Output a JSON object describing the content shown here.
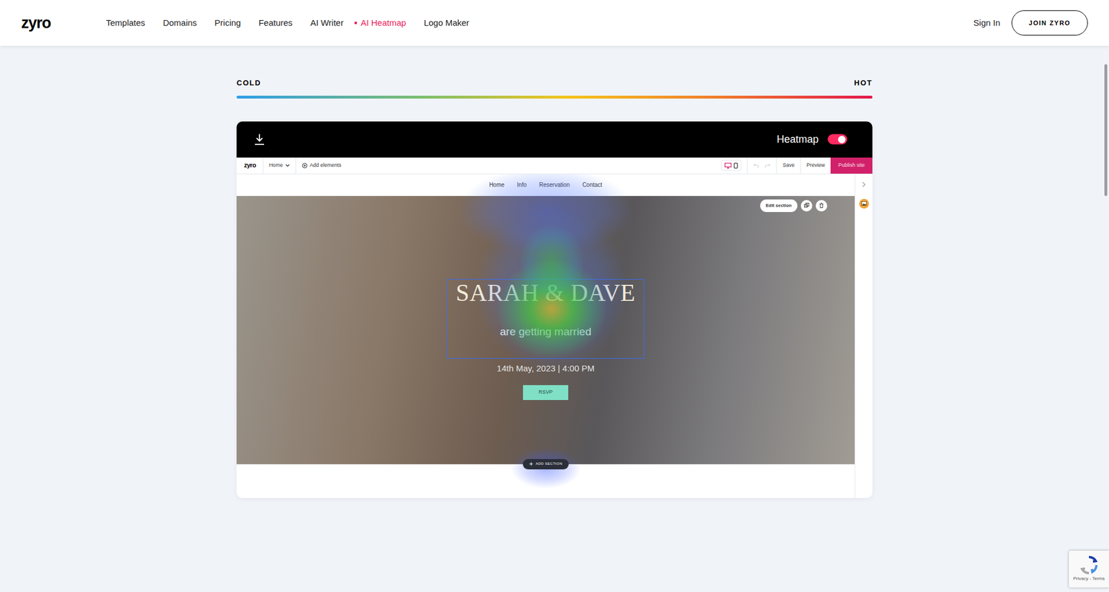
{
  "header": {
    "logo": "zyro",
    "nav": [
      {
        "label": "Templates",
        "selected": false
      },
      {
        "label": "Domains",
        "selected": false
      },
      {
        "label": "Pricing",
        "selected": false
      },
      {
        "label": "Features",
        "selected": false
      },
      {
        "label": "AI Writer",
        "selected": false
      },
      {
        "label": "AI Heatmap",
        "selected": true
      },
      {
        "label": "Logo Maker",
        "selected": false
      }
    ],
    "sign_in": "Sign In",
    "join": "JOIN ZYRO"
  },
  "scale": {
    "cold": "COLD",
    "hot": "HOT"
  },
  "viewer": {
    "toggle_label": "Heatmap",
    "heatmap_on": true
  },
  "editor": {
    "logo": "zyro",
    "page_select": "Home",
    "add_elements": "Add elements",
    "devices": [
      {
        "kind": "desktop",
        "selected": true
      },
      {
        "kind": "mobile",
        "selected": false
      }
    ],
    "save": "Save",
    "preview": "Preview",
    "publish": "Publish site"
  },
  "site": {
    "nav": [
      "Home",
      "Info",
      "Reservation",
      "Contact"
    ],
    "title": "SARAH & DAVE",
    "subtitle": "are getting married",
    "date": "14th May, 2023 | 4:00 PM",
    "rsvp": "RSVP",
    "edit_section": "Edit section",
    "add_section": "ADD SECTION"
  },
  "recaptcha": {
    "text": "Privacy - Terms"
  }
}
